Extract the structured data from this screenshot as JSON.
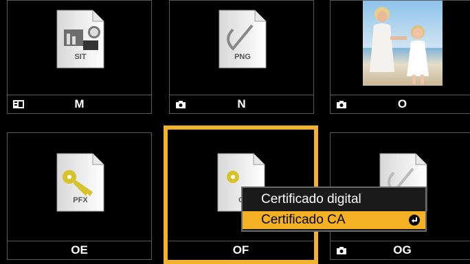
{
  "tiles": [
    {
      "label": "M",
      "ext": "SIT",
      "icon": "slideshow-icon"
    },
    {
      "label": "N",
      "ext": "PNG",
      "icon": "camera-icon"
    },
    {
      "label": "O",
      "ext": "",
      "icon": "camera-icon"
    },
    {
      "label": "OE",
      "ext": "PFX",
      "icon": ""
    },
    {
      "label": "OF",
      "ext": "C",
      "icon": ""
    },
    {
      "label": "OG",
      "ext": "",
      "icon": "camera-icon"
    }
  ],
  "menu": {
    "items": [
      "Certificado digital",
      "Certificado CA"
    ],
    "selected_index": 1
  },
  "colors": {
    "selection": "#f3b22c",
    "menu_highlight": "#f4b124",
    "border": "#5a5a5a"
  }
}
